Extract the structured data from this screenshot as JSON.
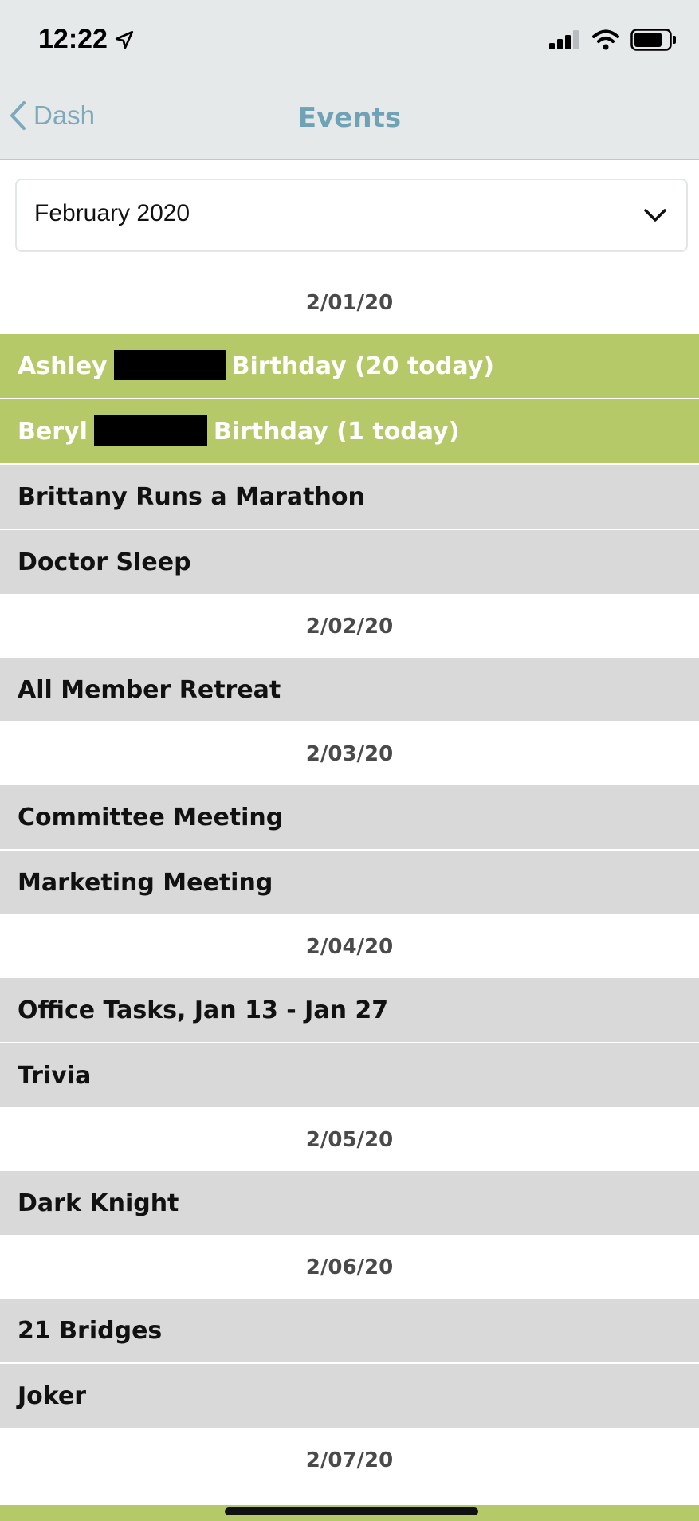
{
  "status": {
    "time": "12:22"
  },
  "nav": {
    "back_label": "Dash",
    "title": "Events"
  },
  "month_select": {
    "value": "February 2020"
  },
  "groups": [
    {
      "date": "2/01/20",
      "events": [
        {
          "first": "Ashley",
          "rest": "Birthday (20 today)",
          "type": "birthday"
        },
        {
          "first": "Beryl",
          "rest": "Birthday (1 today)",
          "type": "birthday"
        },
        {
          "label": "Brittany Runs a Marathon"
        },
        {
          "label": "Doctor Sleep"
        }
      ]
    },
    {
      "date": "2/02/20",
      "events": [
        {
          "label": "All Member Retreat"
        }
      ]
    },
    {
      "date": "2/03/20",
      "events": [
        {
          "label": "Committee Meeting"
        },
        {
          "label": "Marketing Meeting"
        }
      ]
    },
    {
      "date": "2/04/20",
      "events": [
        {
          "label": "Office Tasks, Jan 13 - Jan 27"
        },
        {
          "label": "Trivia"
        }
      ]
    },
    {
      "date": "2/05/20",
      "events": [
        {
          "label": "Dark Knight"
        }
      ]
    },
    {
      "date": "2/06/20",
      "events": [
        {
          "label": "21 Bridges"
        },
        {
          "label": "Joker"
        }
      ]
    },
    {
      "date": "2/07/20",
      "events": []
    }
  ],
  "colors": {
    "birthday_bg": "#b5c968",
    "event_bg": "#d9d9d9",
    "accent": "#6fa2b4"
  }
}
